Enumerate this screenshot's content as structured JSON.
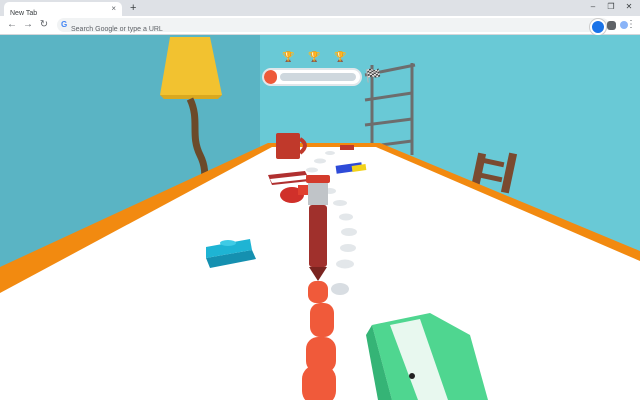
{
  "browser": {
    "tab_title": "New Tab",
    "tab_close_glyph": "×",
    "new_tab_glyph": "+",
    "omnibox_placeholder": "Search Google or type a URL",
    "google_glyph": "G",
    "star_glyph": "☆",
    "menu_glyph": "⋮",
    "back_glyph": "←",
    "forward_glyph": "→",
    "reload_glyph": "↻",
    "window_controls": [
      "–",
      "❐",
      "✕"
    ],
    "icons": [
      "back-icon",
      "forward-icon",
      "reload-icon",
      "google-icon",
      "star-icon",
      "profile-extension-icon",
      "puzzle-extension-icon",
      "avatar-icon",
      "menu-icon"
    ]
  },
  "game": {
    "progress_fraction": 0.12,
    "checkpoints": 3,
    "trophy_glyph": "🏆",
    "flag_glyph": "🏁",
    "colors": {
      "sky_wall": "#69c9d6",
      "table_top": "#ffffff",
      "table_edge": "#f28a10",
      "ink_trail": "#f05a3a",
      "pen_body": "#a0302c",
      "sharpener": "#4fd690",
      "lego": "#1eb4d4",
      "mug": "#c0392b",
      "lamp_shade": "#f2c230"
    },
    "objects": [
      "lamp",
      "shelf",
      "chair",
      "mug",
      "book",
      "pushpin",
      "lego-brick",
      "pencil-sharpener",
      "marker-pen",
      "ink-trail",
      "dotted-path",
      "eraser"
    ]
  }
}
